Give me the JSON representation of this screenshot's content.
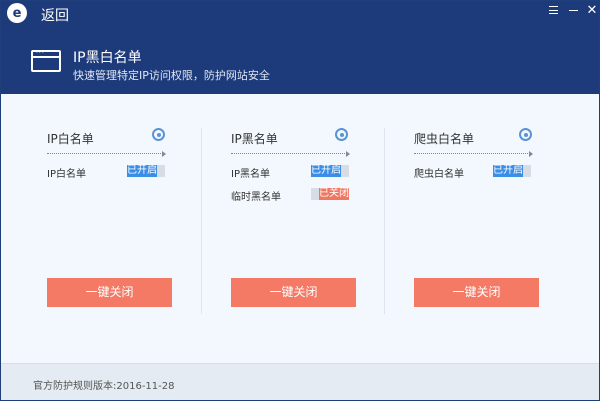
{
  "titlebar": {
    "logo_letter": "e",
    "back_label": "返回"
  },
  "header": {
    "title": "IP黑白名单",
    "subtitle": "快速管理特定IP访问权限，防护网站安全"
  },
  "columns": [
    {
      "title": "IP白名单",
      "rows": [
        {
          "label": "IP白名单",
          "status": "已开启",
          "state": "on"
        }
      ],
      "button_label": "一键关闭"
    },
    {
      "title": "IP黑名单",
      "rows": [
        {
          "label": "IP黑名单",
          "status": "已开启",
          "state": "on"
        },
        {
          "label": "临时黑名单",
          "status": "已关闭",
          "state": "off"
        }
      ],
      "button_label": "一键关闭"
    },
    {
      "title": "爬虫白名单",
      "rows": [
        {
          "label": "爬虫白名单",
          "status": "已开启",
          "state": "on"
        }
      ],
      "button_label": "一键关闭"
    }
  ],
  "footer": {
    "version_text": "官方防护规则版本:2016-11-28"
  },
  "colors": {
    "header_bg": "#1d3b7a",
    "toggle_on": "#3a8ee6",
    "toggle_off": "#f0765f",
    "action_button": "#f47a66"
  }
}
